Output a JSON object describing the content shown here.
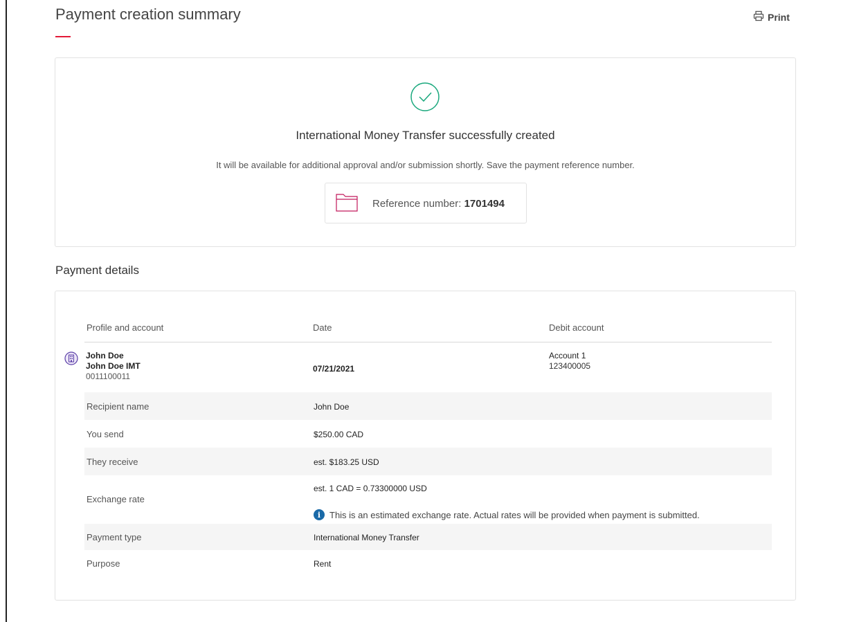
{
  "header": {
    "title": "Payment creation summary",
    "print_label": "Print"
  },
  "success": {
    "title": "International Money Transfer successfully created",
    "subtitle": "It will be available for additional approval and/or submission shortly. Save the payment reference number.",
    "reference_label": "Reference number:",
    "reference_number": "1701494"
  },
  "details": {
    "section_title": "Payment details",
    "columns": [
      "Profile and account",
      "Date",
      "Debit account"
    ],
    "profile": {
      "name": "John Doe",
      "profile": "John Doe IMT",
      "number": "0011100011"
    },
    "date": "07/21/2021",
    "debit_account": {
      "name": "Account 1",
      "number": "123400005"
    },
    "rows": [
      {
        "label": "Recipient name",
        "value": "John Doe"
      },
      {
        "label": "You send",
        "value": "$250.00 CAD"
      },
      {
        "label": "They receive",
        "value": "est. $183.25 USD"
      },
      {
        "label": "Exchange rate",
        "value": "est. 1 CAD = 0.73300000 USD",
        "note": "This is an estimated exchange rate. Actual rates will be provided when payment is submitted."
      },
      {
        "label": "Payment type",
        "value": "International Money Transfer"
      },
      {
        "label": "Purpose",
        "value": "Rent"
      }
    ]
  },
  "colors": {
    "accent_red": "#e31937",
    "success_green": "#1aa87d",
    "folder_pink": "#c2185b",
    "info_blue": "#1a6aa8"
  }
}
